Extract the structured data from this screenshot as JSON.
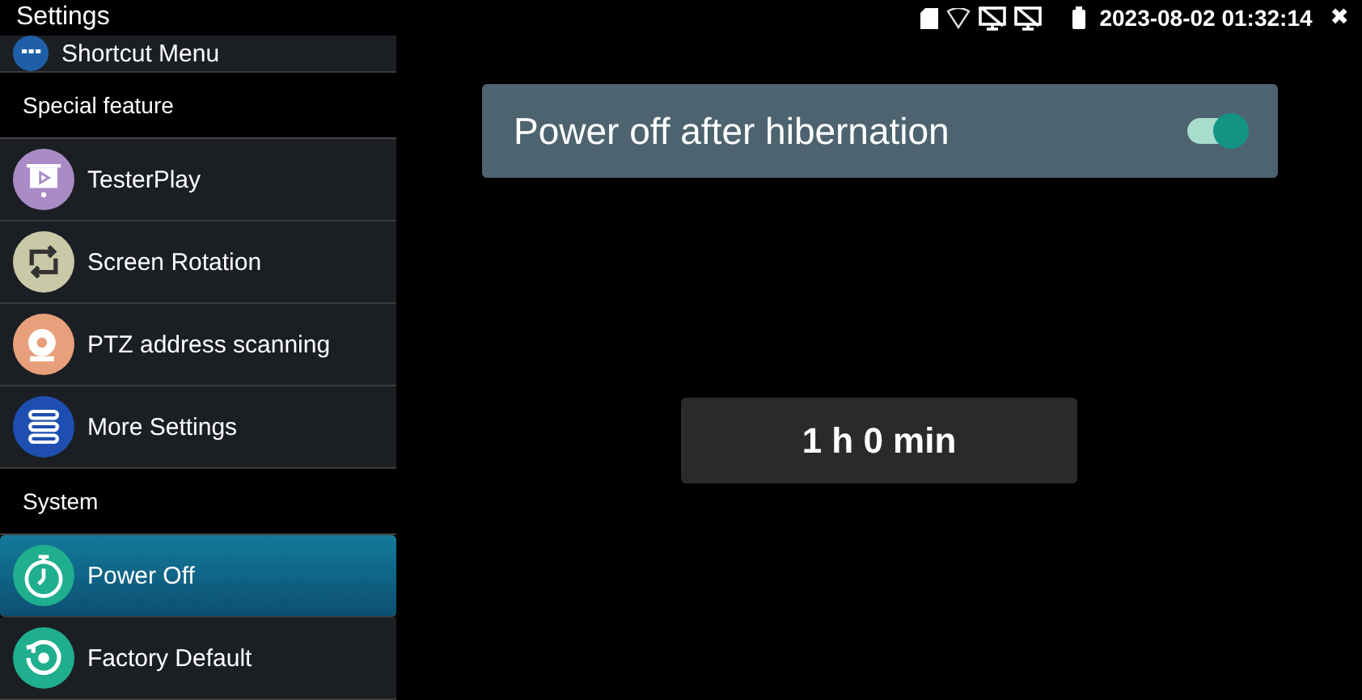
{
  "window": {
    "title": "Settings"
  },
  "status_bar": {
    "datetime": "2023-08-02 01:32:14",
    "close": "✖"
  },
  "sidebar": {
    "items": [
      {
        "kind": "item",
        "label": "Shortcut Menu",
        "color": "#1f5fa8",
        "selected": false
      },
      {
        "kind": "header",
        "label": "Special feature"
      },
      {
        "kind": "item",
        "label": "TesterPlay",
        "color": "#a98bc6",
        "selected": false
      },
      {
        "kind": "item",
        "label": "Screen Rotation",
        "color": "#c9c9a8",
        "selected": false
      },
      {
        "kind": "item",
        "label": "PTZ address scanning",
        "color": "#e8a07c",
        "selected": false
      },
      {
        "kind": "item",
        "label": "More Settings",
        "color": "#1e4fb0",
        "selected": false
      },
      {
        "kind": "header",
        "label": "System"
      },
      {
        "kind": "item",
        "label": "Power Off",
        "color": "#1fae8e",
        "selected": true
      },
      {
        "kind": "item",
        "label": "Factory Default",
        "color": "#1fae8e",
        "selected": false
      }
    ]
  },
  "setting": {
    "label": "Power off after hibernation",
    "on": true
  },
  "time_value": "1 h 0 min"
}
